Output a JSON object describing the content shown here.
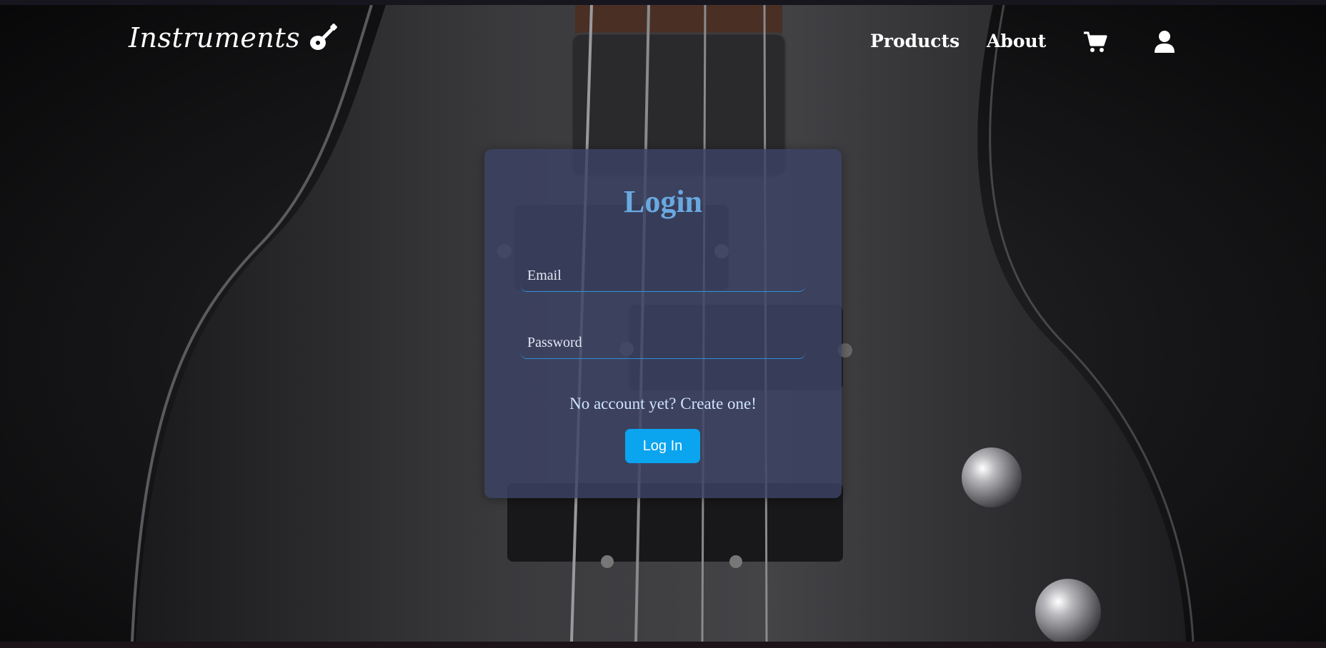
{
  "header": {
    "brand": "Instruments",
    "nav": {
      "products": "Products",
      "about": "About"
    },
    "icons": {
      "brand_icon": "guitar-icon",
      "cart_icon": "cart-icon",
      "user_icon": "user-icon"
    }
  },
  "login": {
    "title": "Login",
    "email_placeholder": "Email",
    "password_placeholder": "Password",
    "signup_text": "No account yet? Create one!",
    "submit_label": "Log In"
  },
  "colors": {
    "accent": "#0aa4ef",
    "title": "#69a9df",
    "card": "#3c4264"
  }
}
